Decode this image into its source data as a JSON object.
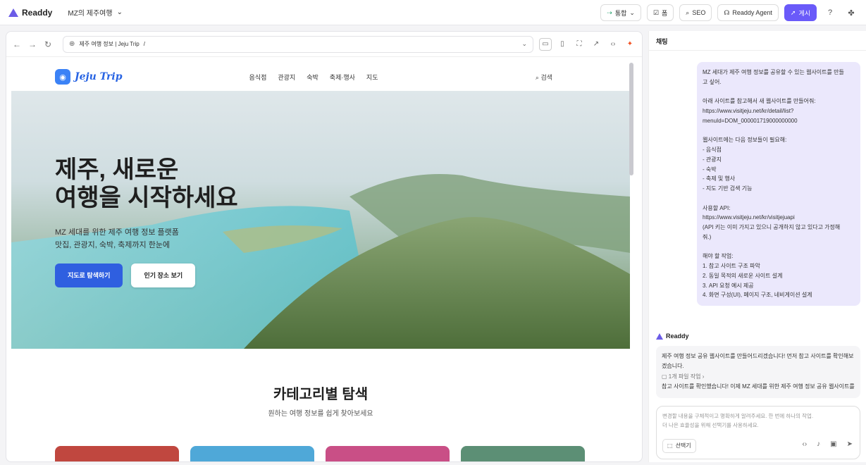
{
  "app": {
    "name": "Readdy",
    "project": "MZ의 제주여행"
  },
  "toolbar": {
    "integration": "통합",
    "form": "폼",
    "seo": "SEO",
    "agent": "Readdy Agent",
    "publish": "게시"
  },
  "browser": {
    "url_text": "제주 여행 정보 | Jeju Trip",
    "url_path": "/"
  },
  "site": {
    "logo": "Jeju Trip",
    "menu": [
      "음식점",
      "관광지",
      "숙박",
      "축제·행사",
      "지도"
    ],
    "search": "검색",
    "hero_title": "제주, 새로운\n여행을 시작하세요",
    "hero_sub": "MZ 세대를 위한 제주 여행 정보 플랫폼\n맛집, 관광지, 숙박, 축제까지 한눈에",
    "btn_map": "지도로 탐색하기",
    "btn_popular": "인기 장소 보기",
    "cat_title": "카테고리별 탐색",
    "cat_sub": "원하는 여행 정보를 쉽게 찾아보세요"
  },
  "chat": {
    "title": "채팅",
    "user_message": "MZ 세대가 제주 여행 정보를 공유할 수 있는 웹사이트를 만들\n고 싶어.\n\n아래 사이트를 참고해서 새 웹사이트를 만들어줘:\nhttps://www.visitjeju.net/kr/detail/list?\nmenuId=DOM_000001719000000000\n\n웹사이트에는 다음 정보들이 필요해:\n- 음식점\n- 관광지\n- 숙박\n- 축제 및 행사\n- 지도 기반 검색 기능\n\n사용할 API:\nhttps://www.visitjeju.net/kr/visitjejuapi\n(API 키는 이미 가지고 있으니 공개하지 않고 있다고 가정해\n줘.)\n\n해야 할 작업:\n1. 참고 사이트 구조 파악\n2. 동일 목적의 새로운 사이트 설계\n3. API 요청 예시 제공\n4. 화면 구성(UI), 페이지 구조, 네비게이션 설계",
    "bot_name": "Readdy",
    "bot_message": "제주 여행 정보 공유 웹사이트를 만들어드리겠습니다! 먼저 참고 사이트를 확인해보겠습니다.",
    "bot_file": "1개 파일 작업",
    "bot_more": "참고 사이트를 확인했습니다! 이제 MZ 세대를 위한 제주 여행 정보 공유 웹사이트를",
    "input_placeholder": "변경할 내용을 구체적이고 명확하게 알려주세요. 한 번에 하나의 작업.\n더 나은 효율성을 위해 선택기를 사용하세요.",
    "selector": "선택기"
  },
  "colors": {
    "accent": "#6a5af9",
    "brand": "#2f5fe0"
  }
}
